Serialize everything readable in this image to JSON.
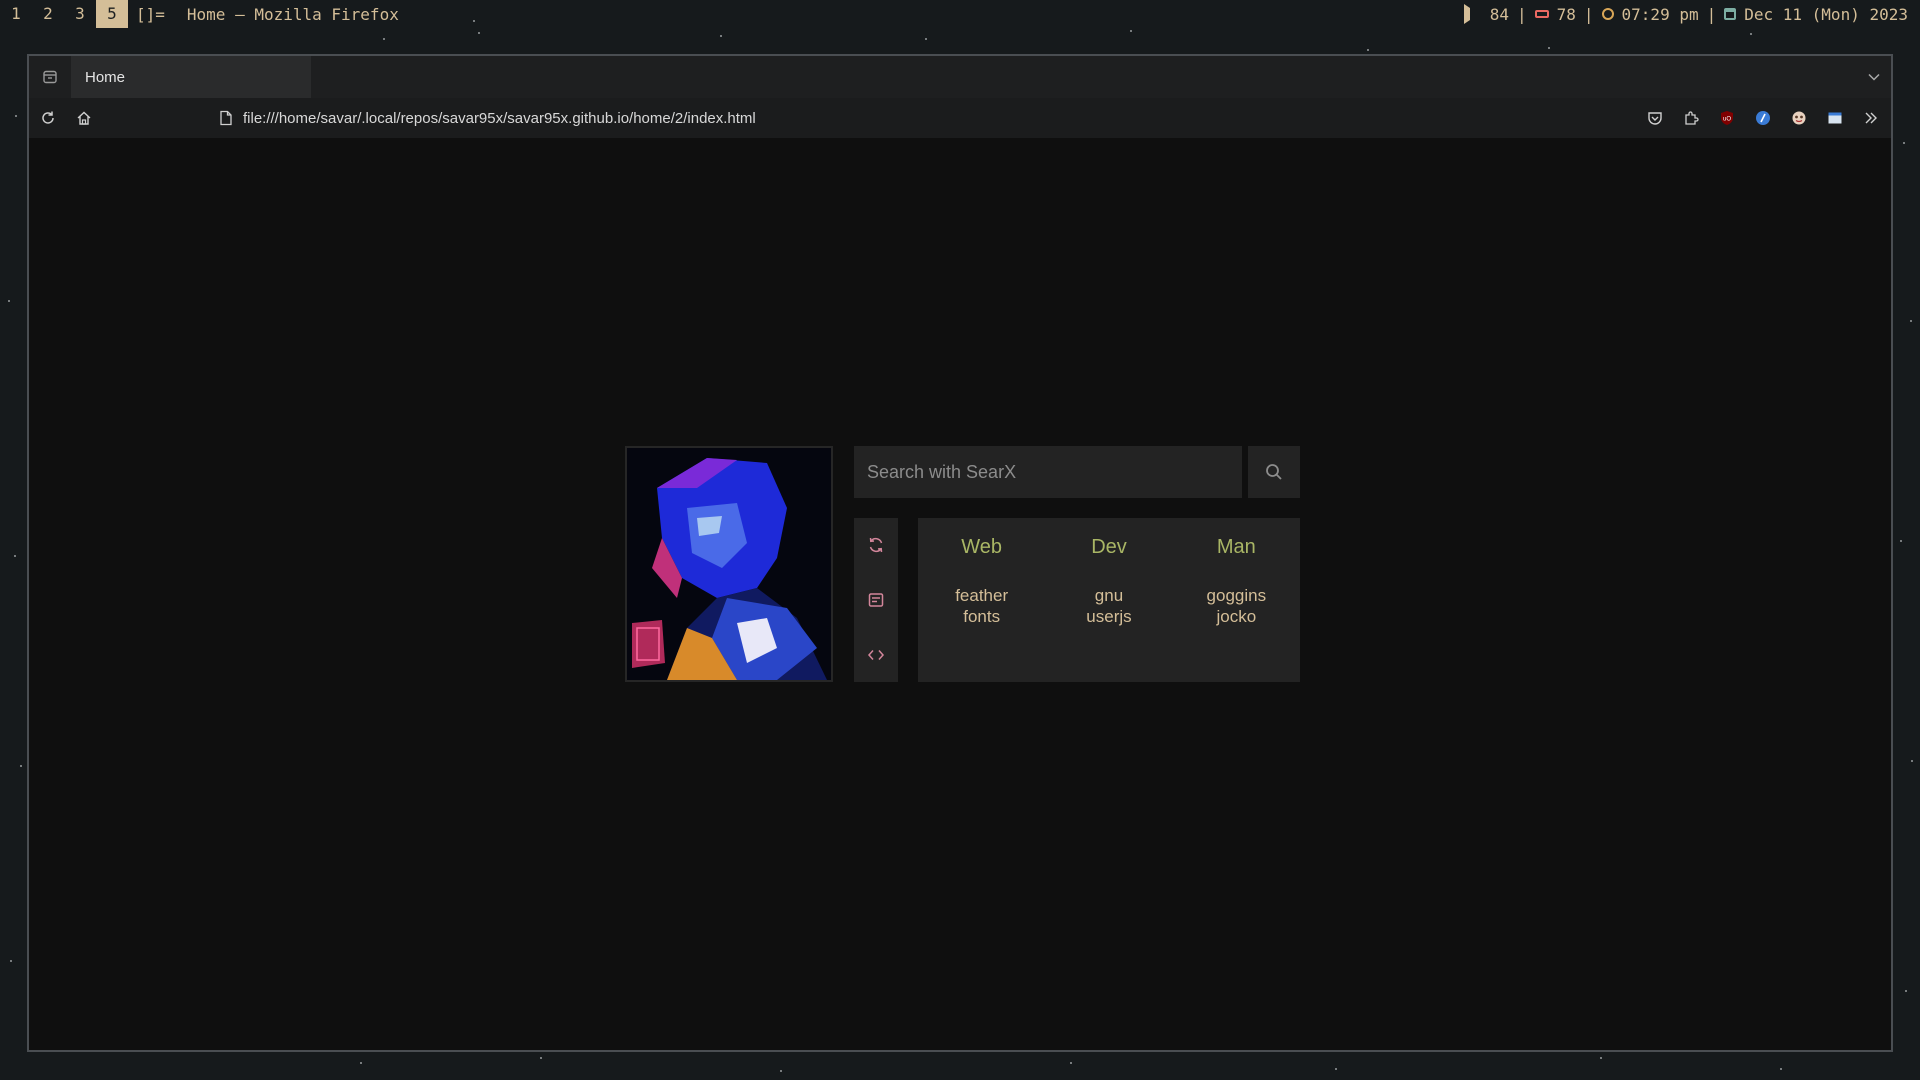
{
  "topbar": {
    "workspaces": [
      "1",
      "2",
      "3",
      "5"
    ],
    "active_workspace": "5",
    "layout": "[]=",
    "window_title": "Home — Mozilla Firefox",
    "volume": "84",
    "battery": "78",
    "time": "07:29 pm",
    "date": "Dec 11 (Mon) 2023",
    "separator": "|"
  },
  "browser": {
    "tab_title": "Home",
    "url": "file:///home/savar/.local/repos/savar95x/savar95x.github.io/home/2/index.html",
    "extension_icons": [
      "pocket-icon",
      "extensions-icon",
      "ublock-origin-icon",
      "bitwarden-icon",
      "tampermonkey-icon",
      "window-icon",
      "overflow-icon"
    ]
  },
  "startpage": {
    "search_placeholder": "Search with SearX",
    "side_buttons": [
      "refresh-icon",
      "notes-icon",
      "code-icon"
    ],
    "columns": [
      {
        "title": "Web",
        "links": [
          "feather",
          "fonts"
        ]
      },
      {
        "title": "Dev",
        "links": [
          "gnu",
          "userjs"
        ]
      },
      {
        "title": "Man",
        "links": [
          "goggins",
          "jocko"
        ]
      }
    ],
    "portrait_alt": ""
  },
  "colors": {
    "fg": "#d4be98",
    "accent_green": "#a9b665",
    "accent_pink": "#d3869b",
    "panel_bg": "#232323",
    "page_bg": "#0f0f0f"
  }
}
